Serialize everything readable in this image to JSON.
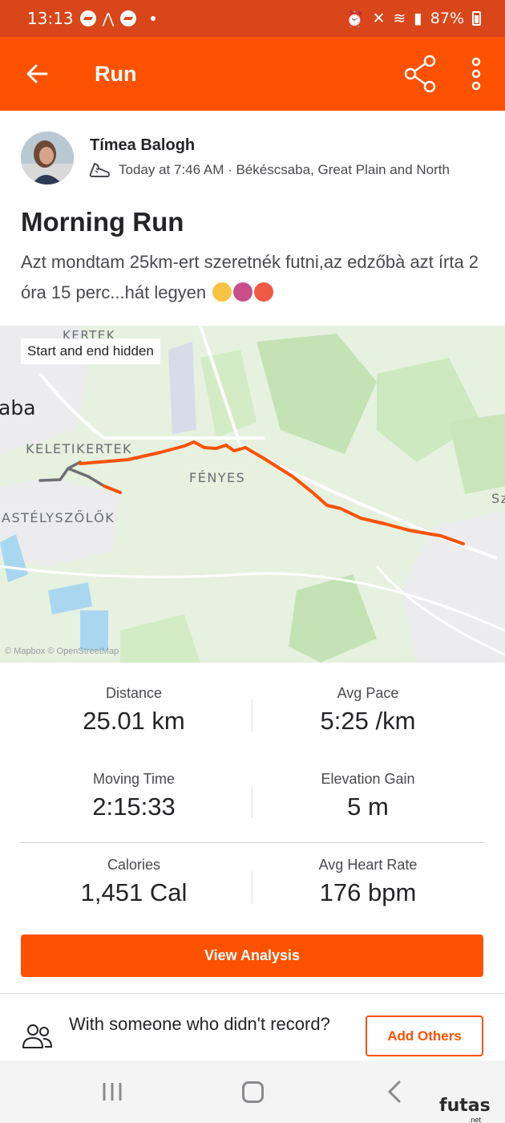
{
  "status_bar": {
    "time": "13:13",
    "battery": "87%"
  },
  "app_bar": {
    "title": "Run"
  },
  "athlete": {
    "name": "Tímea Balogh",
    "meta": "Today at 7:46 AM · Békéscsaba, Great Plain and North"
  },
  "activity": {
    "title": "Morning Run",
    "description": "Azt mondtam 25km-ert szeretnék futni,az edzőbà azt írta 2 óra 15 perc...hát legyen"
  },
  "map": {
    "privacy_chip": "Start and end hidden",
    "labels": {
      "kertek": "KERTEK",
      "aba": "aba",
      "keletikertek": "KELETIKERTEK",
      "fenyes": "FÉNYES",
      "kastelyszolok": "ASTÉLYSZŐLŐK",
      "edge": "Sz"
    },
    "attribution": "© Mapbox © OpenStreetMap",
    "route_color": "#fc5200"
  },
  "stats": [
    {
      "label": "Distance",
      "value": "25.01 km"
    },
    {
      "label": "Avg Pace",
      "value": "5:25 /km"
    },
    {
      "label": "Moving Time",
      "value": "2:15:33"
    },
    {
      "label": "Elevation Gain",
      "value": "5 m"
    },
    {
      "label": "Calories",
      "value": "1,451 Cal"
    },
    {
      "label": "Avg Heart Rate",
      "value": "176 bpm"
    }
  ],
  "actions": {
    "view_analysis": "View Analysis",
    "with_someone": "With someone who didn't record?",
    "add_others": "Add Others"
  },
  "watermark": {
    "brand": "futas",
    "suffix": ".net"
  },
  "colors": {
    "brand": "#fc5200",
    "status_bar": "#d9461a"
  }
}
